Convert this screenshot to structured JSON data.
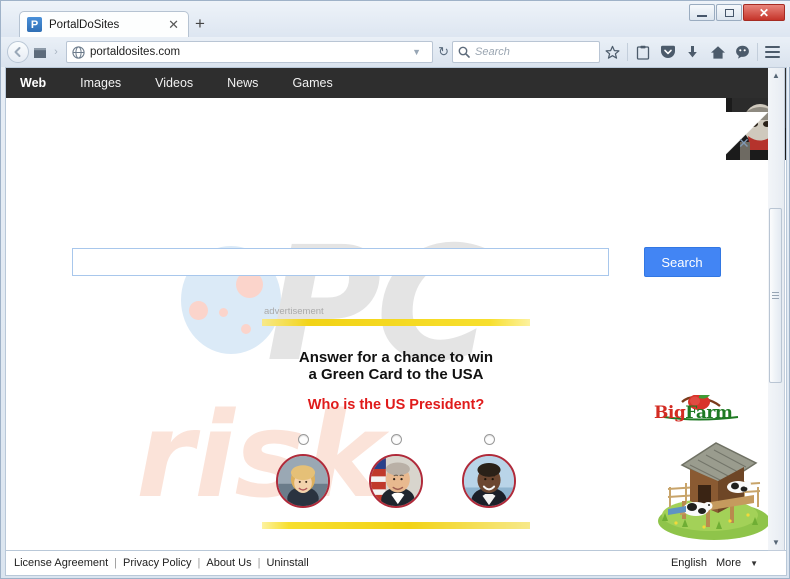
{
  "browser": {
    "tab": {
      "title": "PortalDoSites",
      "favicon_letter": "P",
      "close_label": "✕"
    },
    "new_tab_label": "+",
    "window_controls": {
      "minimize": "—",
      "maximize": "□",
      "close": "✕"
    },
    "url": "portaldosites.com",
    "search_placeholder": "Search",
    "toolbar_icons": [
      "bookmark-star-icon",
      "reader-clipboard-icon",
      "pocket-icon",
      "downloads-icon",
      "home-icon",
      "chat-icon",
      "menu-hamburger-icon"
    ]
  },
  "site": {
    "nav": [
      {
        "label": "Web",
        "active": true
      },
      {
        "label": "Images",
        "active": false
      },
      {
        "label": "Videos",
        "active": false
      },
      {
        "label": "News",
        "active": false
      },
      {
        "label": "Games",
        "active": false
      }
    ],
    "search": {
      "value": "",
      "placeholder": "",
      "button_label": "Search"
    },
    "watermark": {
      "pc": "PC",
      "risk": "risk"
    }
  },
  "advertisement": {
    "label": "advertisement",
    "headline_line1": "Answer for a chance to win",
    "headline_line2": "a Green Card to the USA",
    "question": "Who is the US President?",
    "options": [
      {
        "name": "hillary-clinton",
        "selected": false
      },
      {
        "name": "george-w-bush",
        "selected": false
      },
      {
        "name": "barack-obama",
        "selected": false
      }
    ]
  },
  "bigfarm_ad": {
    "brand_part1": "Big",
    "brand_part2": "Farm"
  },
  "corner_ad": {
    "close_label": "✕"
  },
  "footer": {
    "links": [
      "License Agreement",
      "Privacy Policy",
      "About Us",
      "Uninstall"
    ],
    "divider": "|",
    "language": "English",
    "more": "More",
    "more_caret": "▼"
  },
  "colors": {
    "nav_bar": "#2e2e2e",
    "search_button": "#4285f4",
    "question_red": "#e01b1b",
    "ad_yellow": "#f2d316",
    "portrait_ring": "#b02a3a"
  }
}
